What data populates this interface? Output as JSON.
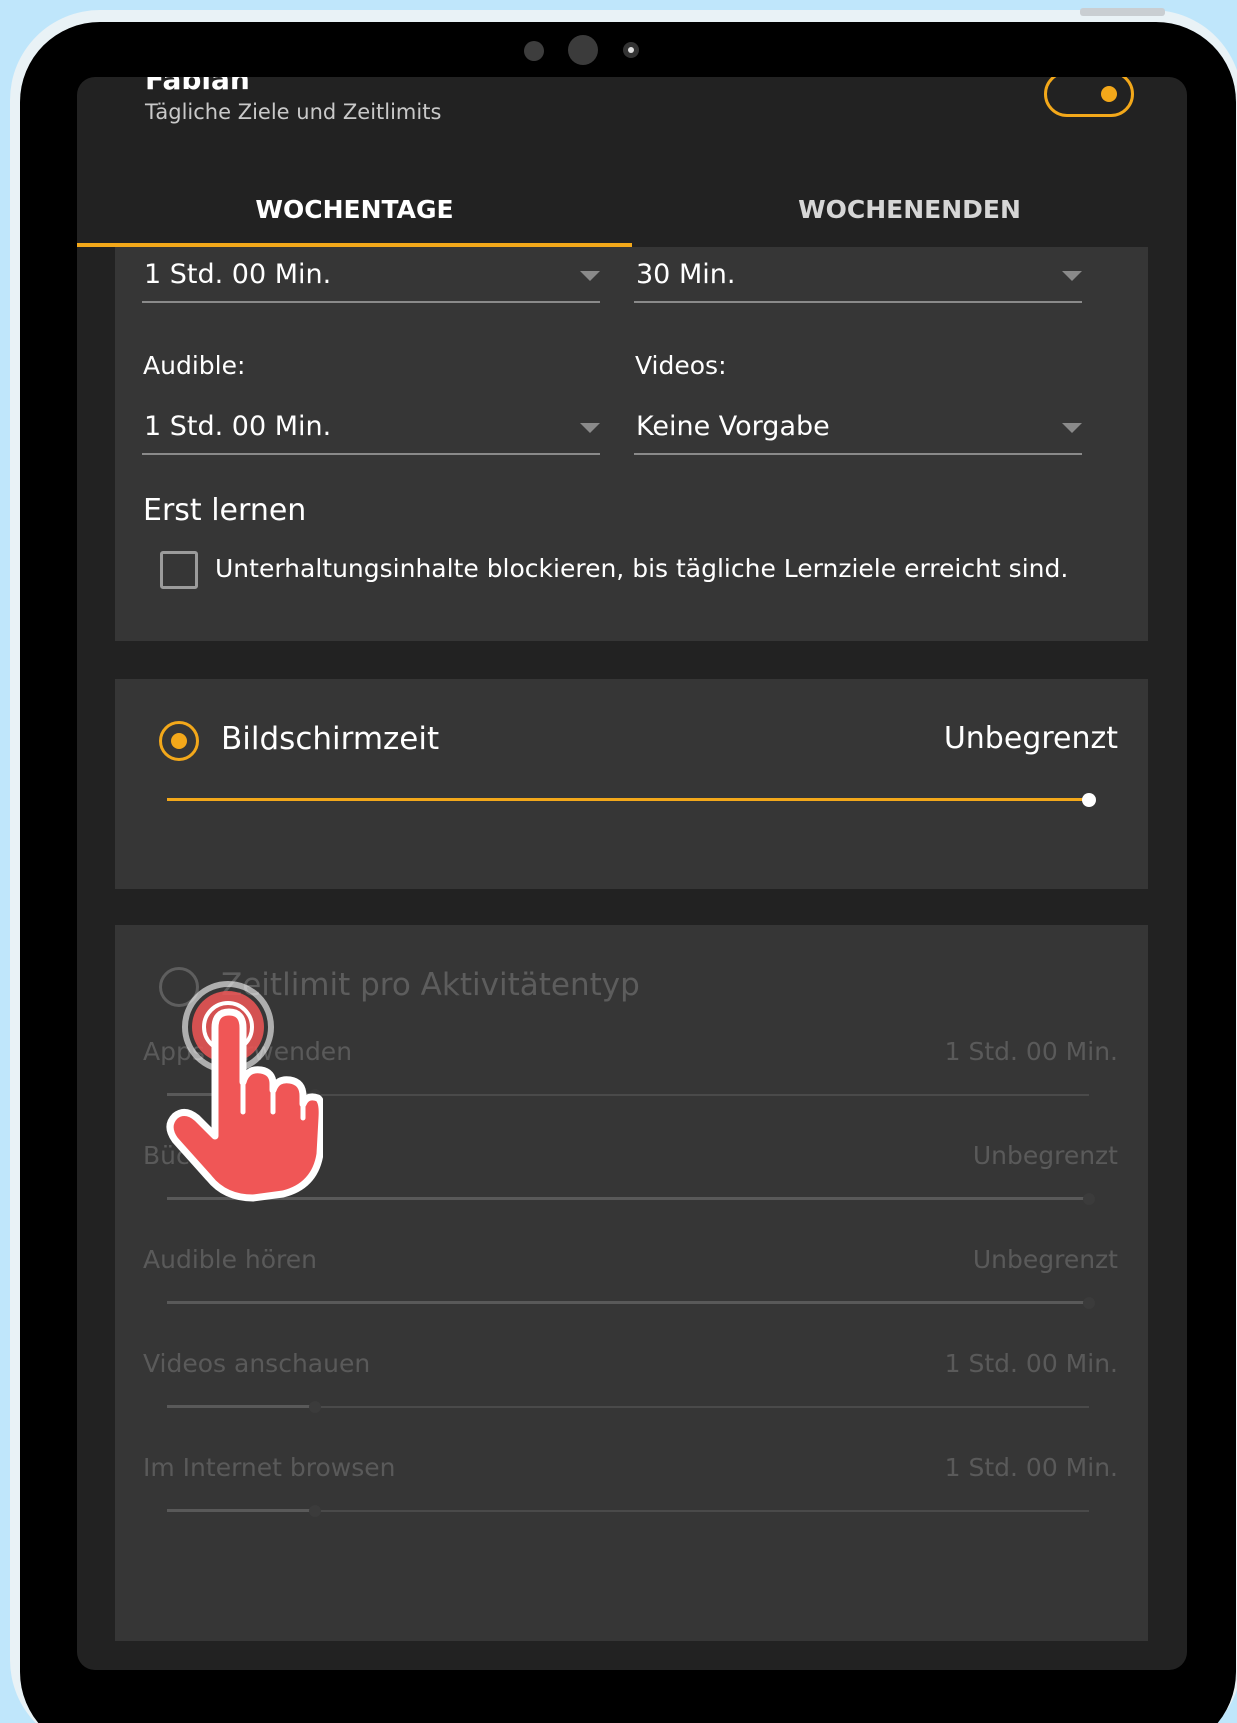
{
  "header": {
    "name": "Fabian",
    "subtitle": "Tägliche Ziele und Zeitlimits"
  },
  "tabs": [
    {
      "label": "WOCHENTAGE",
      "active": true
    },
    {
      "label": "WOCHENENDEN",
      "active": false
    }
  ],
  "goals": {
    "top_left_value": "1 Std. 00 Min.",
    "top_right_value": "30 Min.",
    "audible_label": "Audible:",
    "audible_value": "1 Std. 00 Min.",
    "videos_label": "Videos:",
    "videos_value": "Keine Vorgabe",
    "learn_first_title": "Erst lernen",
    "learn_first_checkbox": "Unterhaltungsinhalte blockieren, bis tägliche Lernziele erreicht sind.",
    "learn_first_checked": false
  },
  "screen_time": {
    "label": "Bildschirmzeit",
    "value": "Unbegrenzt",
    "selected": true,
    "slider_fraction": 1.0
  },
  "per_activity": {
    "label": "Zeitlimit pro Aktivitätentyp",
    "selected": false,
    "items": [
      {
        "label": "Apps verwenden",
        "value": "1 Std. 00 Min.",
        "fraction": 0.16
      },
      {
        "label": "Bücher lesen",
        "value": "Unbegrenzt",
        "fraction": 1.0
      },
      {
        "label": "Audible hören",
        "value": "Unbegrenzt",
        "fraction": 1.0
      },
      {
        "label": "Videos anschauen",
        "value": "1 Std. 00 Min.",
        "fraction": 0.16
      },
      {
        "label": "Im Internet browsen",
        "value": "1 Std. 00 Min.",
        "fraction": 0.16
      }
    ]
  },
  "colors": {
    "accent": "#f3a81a",
    "tap_indicator": "#f05656"
  }
}
